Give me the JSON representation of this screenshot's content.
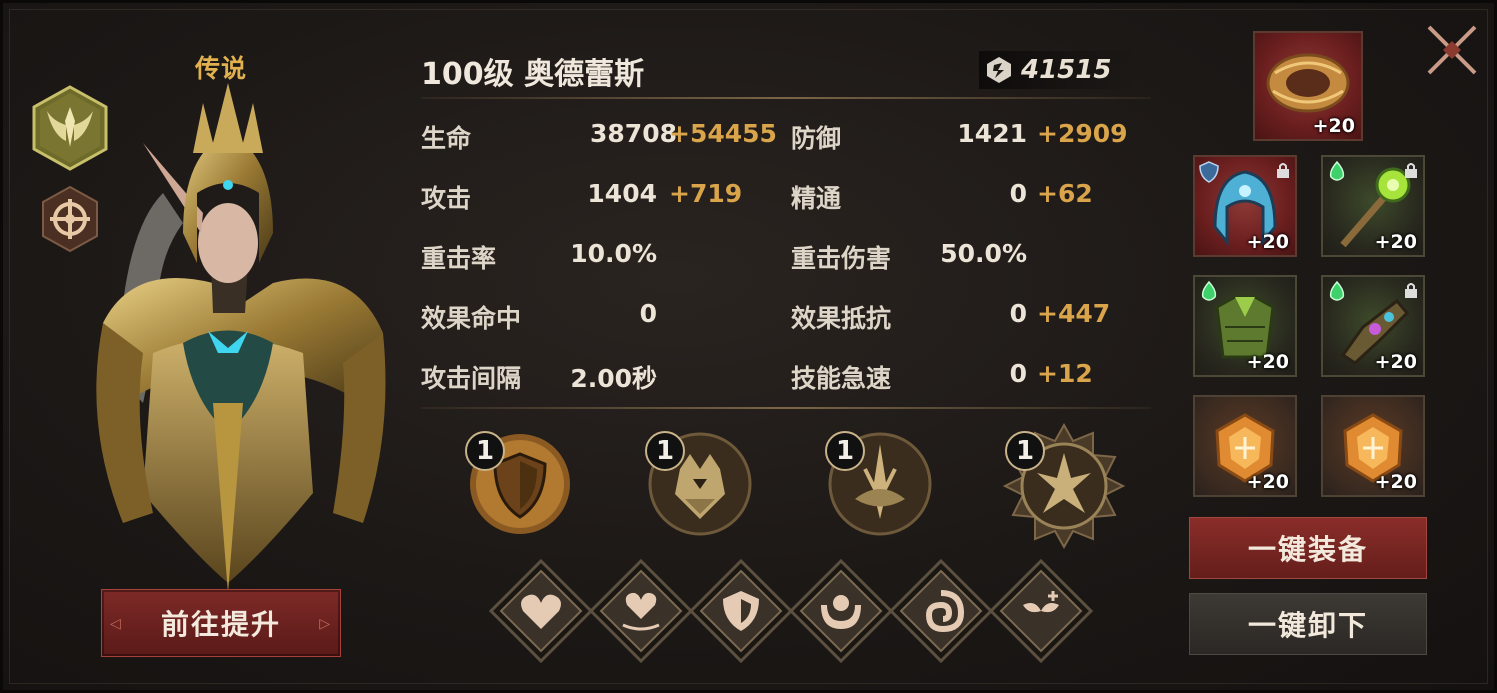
{
  "hero": {
    "rarity": "传说",
    "name": "100级 奥德蕾斯",
    "power": "41515",
    "upgrade_label": "前往提升",
    "class_icon": "winged-crest-icon",
    "element_icon": "compass-star-icon"
  },
  "stats": [
    {
      "label": "生命",
      "value": "38708",
      "bonus": "+54455"
    },
    {
      "label": "防御",
      "value": "1421",
      "bonus": "+2909"
    },
    {
      "label": "攻击",
      "value": "1404",
      "bonus": "+719"
    },
    {
      "label": "精通",
      "value": "0",
      "bonus": "+62"
    },
    {
      "label": "重击率",
      "value": "10.0%",
      "bonus": ""
    },
    {
      "label": "重击伤害",
      "value": "50.0%",
      "bonus": ""
    },
    {
      "label": "效果命中",
      "value": "0",
      "bonus": ""
    },
    {
      "label": "效果抵抗",
      "value": "0",
      "bonus": "+447"
    },
    {
      "label": "攻击间隔",
      "value": "2.00秒",
      "bonus": ""
    },
    {
      "label": "技能急速",
      "value": "0",
      "bonus": "+12"
    }
  ],
  "skills": [
    {
      "name": "shield-skill-icon",
      "level": "1"
    },
    {
      "name": "demon-armor-skill-icon",
      "level": "1"
    },
    {
      "name": "blade-burst-skill-icon",
      "level": "1"
    },
    {
      "name": "thorn-crest-skill-icon",
      "level": "1"
    }
  ],
  "runes": [
    {
      "name": "heart-icon"
    },
    {
      "name": "heart-ripple-icon"
    },
    {
      "name": "shield-crest-icon"
    },
    {
      "name": "embrace-icon"
    },
    {
      "name": "swirl-icon"
    },
    {
      "name": "sprout-plus-icon"
    }
  ],
  "equipment": {
    "top": {
      "name": "chain-bracer",
      "level": "+20"
    },
    "slots": [
      {
        "name": "crystal-helm",
        "level": "+20",
        "locked": true
      },
      {
        "name": "emerald-staff",
        "level": "+20",
        "locked": true
      },
      {
        "name": "vine-armor",
        "level": "+20",
        "locked": false
      },
      {
        "name": "gem-gauntlet",
        "level": "+20",
        "locked": true
      },
      {
        "name": "amber-stone-1",
        "level": "+20",
        "locked": false
      },
      {
        "name": "amber-stone-2",
        "level": "+20",
        "locked": false
      }
    ],
    "equip_all_label": "一键装备",
    "unequip_all_label": "一键卸下"
  },
  "colors": {
    "accent_gold": "#d9a44a",
    "button_red": "#7d2a27",
    "text": "#e8e0d2"
  }
}
